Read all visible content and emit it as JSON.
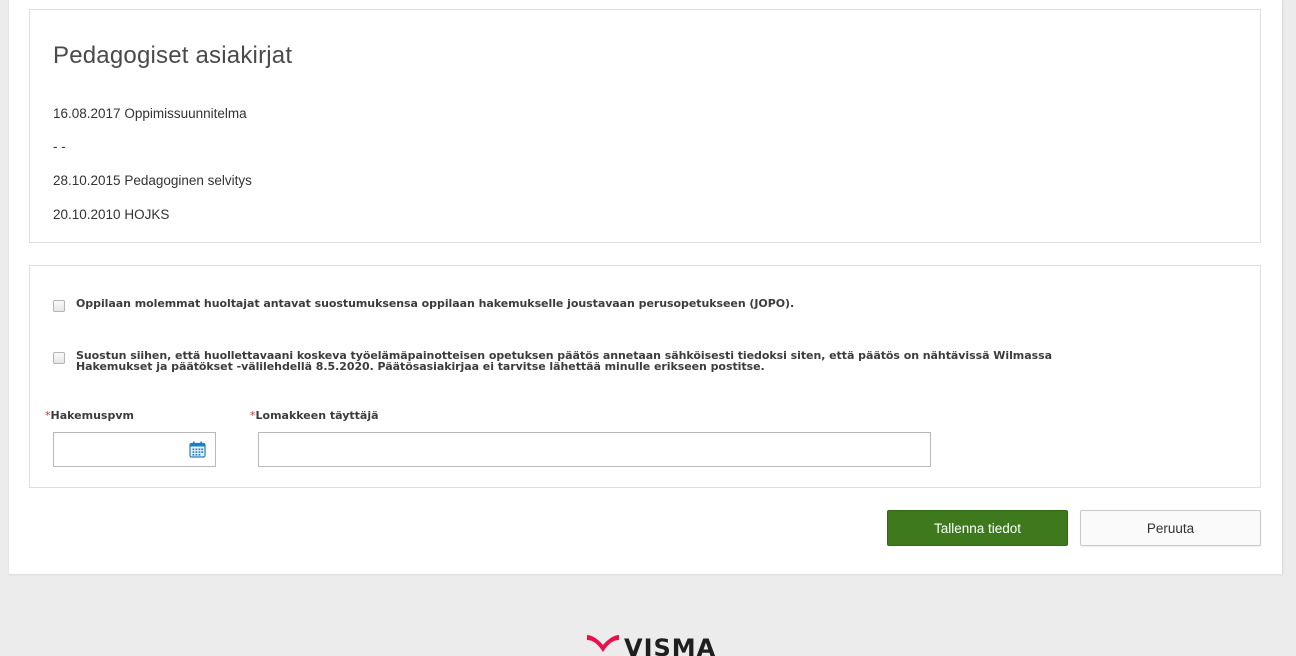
{
  "docs": {
    "title": "Pedagogiset asiakirjat",
    "items": [
      "16.08.2017 Oppimissuunnitelma",
      "- -",
      "28.10.2015 Pedagoginen selvitys",
      "20.10.2010 HOJKS"
    ]
  },
  "form": {
    "consents": [
      {
        "text": "Oppilaan molemmat huoltajat antavat suostumuksensa oppilaan hakemukselle joustavaan perusopetukseen (JOPO).",
        "checked": false
      },
      {
        "text_line1": "Suostun siihen, että huollettavaani koskeva työelämäpainotteisen opetuksen päätös annetaan sähköisesti tiedoksi siten, että päätös on nähtävissä Wilmassa",
        "text_line2": "Hakemukset ja päätökset -välilehdellä 8.5.2020. Päätösasiakirjaa ei tarvitse lähettää minulle erikseen postitse.",
        "checked": false
      }
    ],
    "required_marker": "*",
    "date_label": "Hakemuspvm",
    "date_value": "",
    "filler_label": "Lomakkeen täyttäjä",
    "filler_value": ""
  },
  "actions": {
    "save_label": "Tallenna tiedot",
    "cancel_label": "Peruuta"
  },
  "footer": {
    "logo_text": "VISMA"
  },
  "colors": {
    "save_button": "#3e7a1d",
    "required": "#c0392b",
    "logo_accent": "#e8114a",
    "calendar_icon": "#1c7fc4"
  }
}
